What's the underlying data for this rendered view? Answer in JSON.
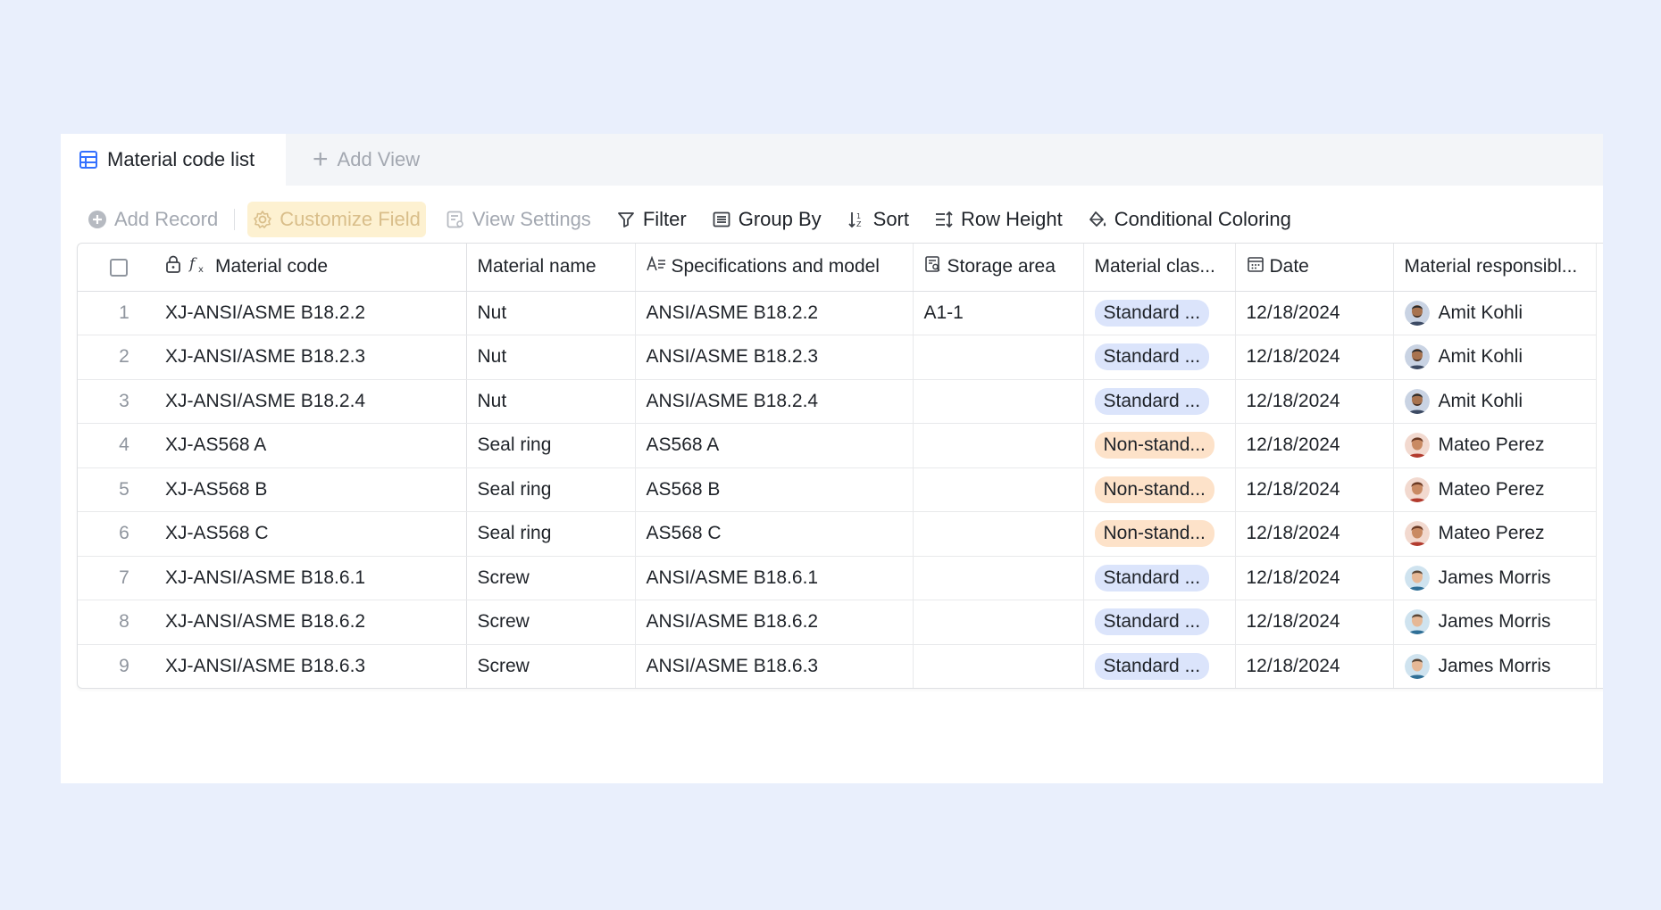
{
  "tabs": {
    "active_label": "Material code list",
    "add_view_label": "Add View"
  },
  "toolbar": {
    "add_record": "Add Record",
    "customize_field": "Customize Field",
    "view_settings": "View Settings",
    "filter": "Filter",
    "group_by": "Group By",
    "sort": "Sort",
    "row_height": "Row Height",
    "conditional_coloring": "Conditional Coloring"
  },
  "columns": {
    "material_code": "Material code",
    "material_name": "Material name",
    "specifications": "Specifications and model",
    "storage_area": "Storage area",
    "material_class": "Material clas...",
    "date": "Date",
    "responsible": "Material responsibl..."
  },
  "rows": [
    {
      "index": "1",
      "code": "XJ-ANSI/ASME B18.2.2",
      "name": "Nut",
      "spec": "ANSI/ASME B18.2.2",
      "storage": "A1-1",
      "class": "Standard ...",
      "class_kind": "std",
      "date": "12/18/2024",
      "owner": "Amit Kohli",
      "avatar": "amit"
    },
    {
      "index": "2",
      "code": "XJ-ANSI/ASME B18.2.3",
      "name": "Nut",
      "spec": "ANSI/ASME B18.2.3",
      "storage": "",
      "class": "Standard ...",
      "class_kind": "std",
      "date": "12/18/2024",
      "owner": "Amit Kohli",
      "avatar": "amit"
    },
    {
      "index": "3",
      "code": "XJ-ANSI/ASME B18.2.4",
      "name": "Nut",
      "spec": "ANSI/ASME B18.2.4",
      "storage": "",
      "class": "Standard ...",
      "class_kind": "std",
      "date": "12/18/2024",
      "owner": "Amit Kohli",
      "avatar": "amit"
    },
    {
      "index": "4",
      "code": "XJ-AS568 A",
      "name": "Seal ring",
      "spec": "AS568 A",
      "storage": "",
      "class": "Non-stand...",
      "class_kind": "non",
      "date": "12/18/2024",
      "owner": "Mateo Perez",
      "avatar": "mateo"
    },
    {
      "index": "5",
      "code": "XJ-AS568 B",
      "name": "Seal ring",
      "spec": "AS568 B",
      "storage": "",
      "class": "Non-stand...",
      "class_kind": "non",
      "date": "12/18/2024",
      "owner": "Mateo Perez",
      "avatar": "mateo"
    },
    {
      "index": "6",
      "code": "XJ-AS568 C",
      "name": "Seal ring",
      "spec": "AS568 C",
      "storage": "",
      "class": "Non-stand...",
      "class_kind": "non",
      "date": "12/18/2024",
      "owner": "Mateo Perez",
      "avatar": "mateo"
    },
    {
      "index": "7",
      "code": "XJ-ANSI/ASME B18.6.1",
      "name": "Screw",
      "spec": "ANSI/ASME B18.6.1",
      "storage": "",
      "class": "Standard ...",
      "class_kind": "std",
      "date": "12/18/2024",
      "owner": "James Morris",
      "avatar": "james"
    },
    {
      "index": "8",
      "code": "XJ-ANSI/ASME B18.6.2",
      "name": "Screw",
      "spec": "ANSI/ASME B18.6.2",
      "storage": "",
      "class": "Standard ...",
      "class_kind": "std",
      "date": "12/18/2024",
      "owner": "James Morris",
      "avatar": "james"
    },
    {
      "index": "9",
      "code": "XJ-ANSI/ASME B18.6.3",
      "name": "Screw",
      "spec": "ANSI/ASME B18.6.3",
      "storage": "",
      "class": "Standard ...",
      "class_kind": "std",
      "date": "12/18/2024",
      "owner": "James Morris",
      "avatar": "james"
    }
  ],
  "colors": {
    "page_bg": "#e9effc",
    "accent": "#3370ff",
    "tag_standard": "#dbe4fb",
    "tag_nonstandard": "#fde2c9",
    "customize_highlight": "#fdf1d1"
  },
  "icons": {
    "tab": "grid-table-icon",
    "add_record": "plus-circle-icon",
    "customize_field": "gear-icon",
    "view_settings": "settings-panel-icon",
    "filter": "filter-icon",
    "group_by": "group-icon",
    "sort": "sort-icon",
    "row_height": "row-height-icon",
    "conditional_coloring": "paint-bucket-icon"
  }
}
